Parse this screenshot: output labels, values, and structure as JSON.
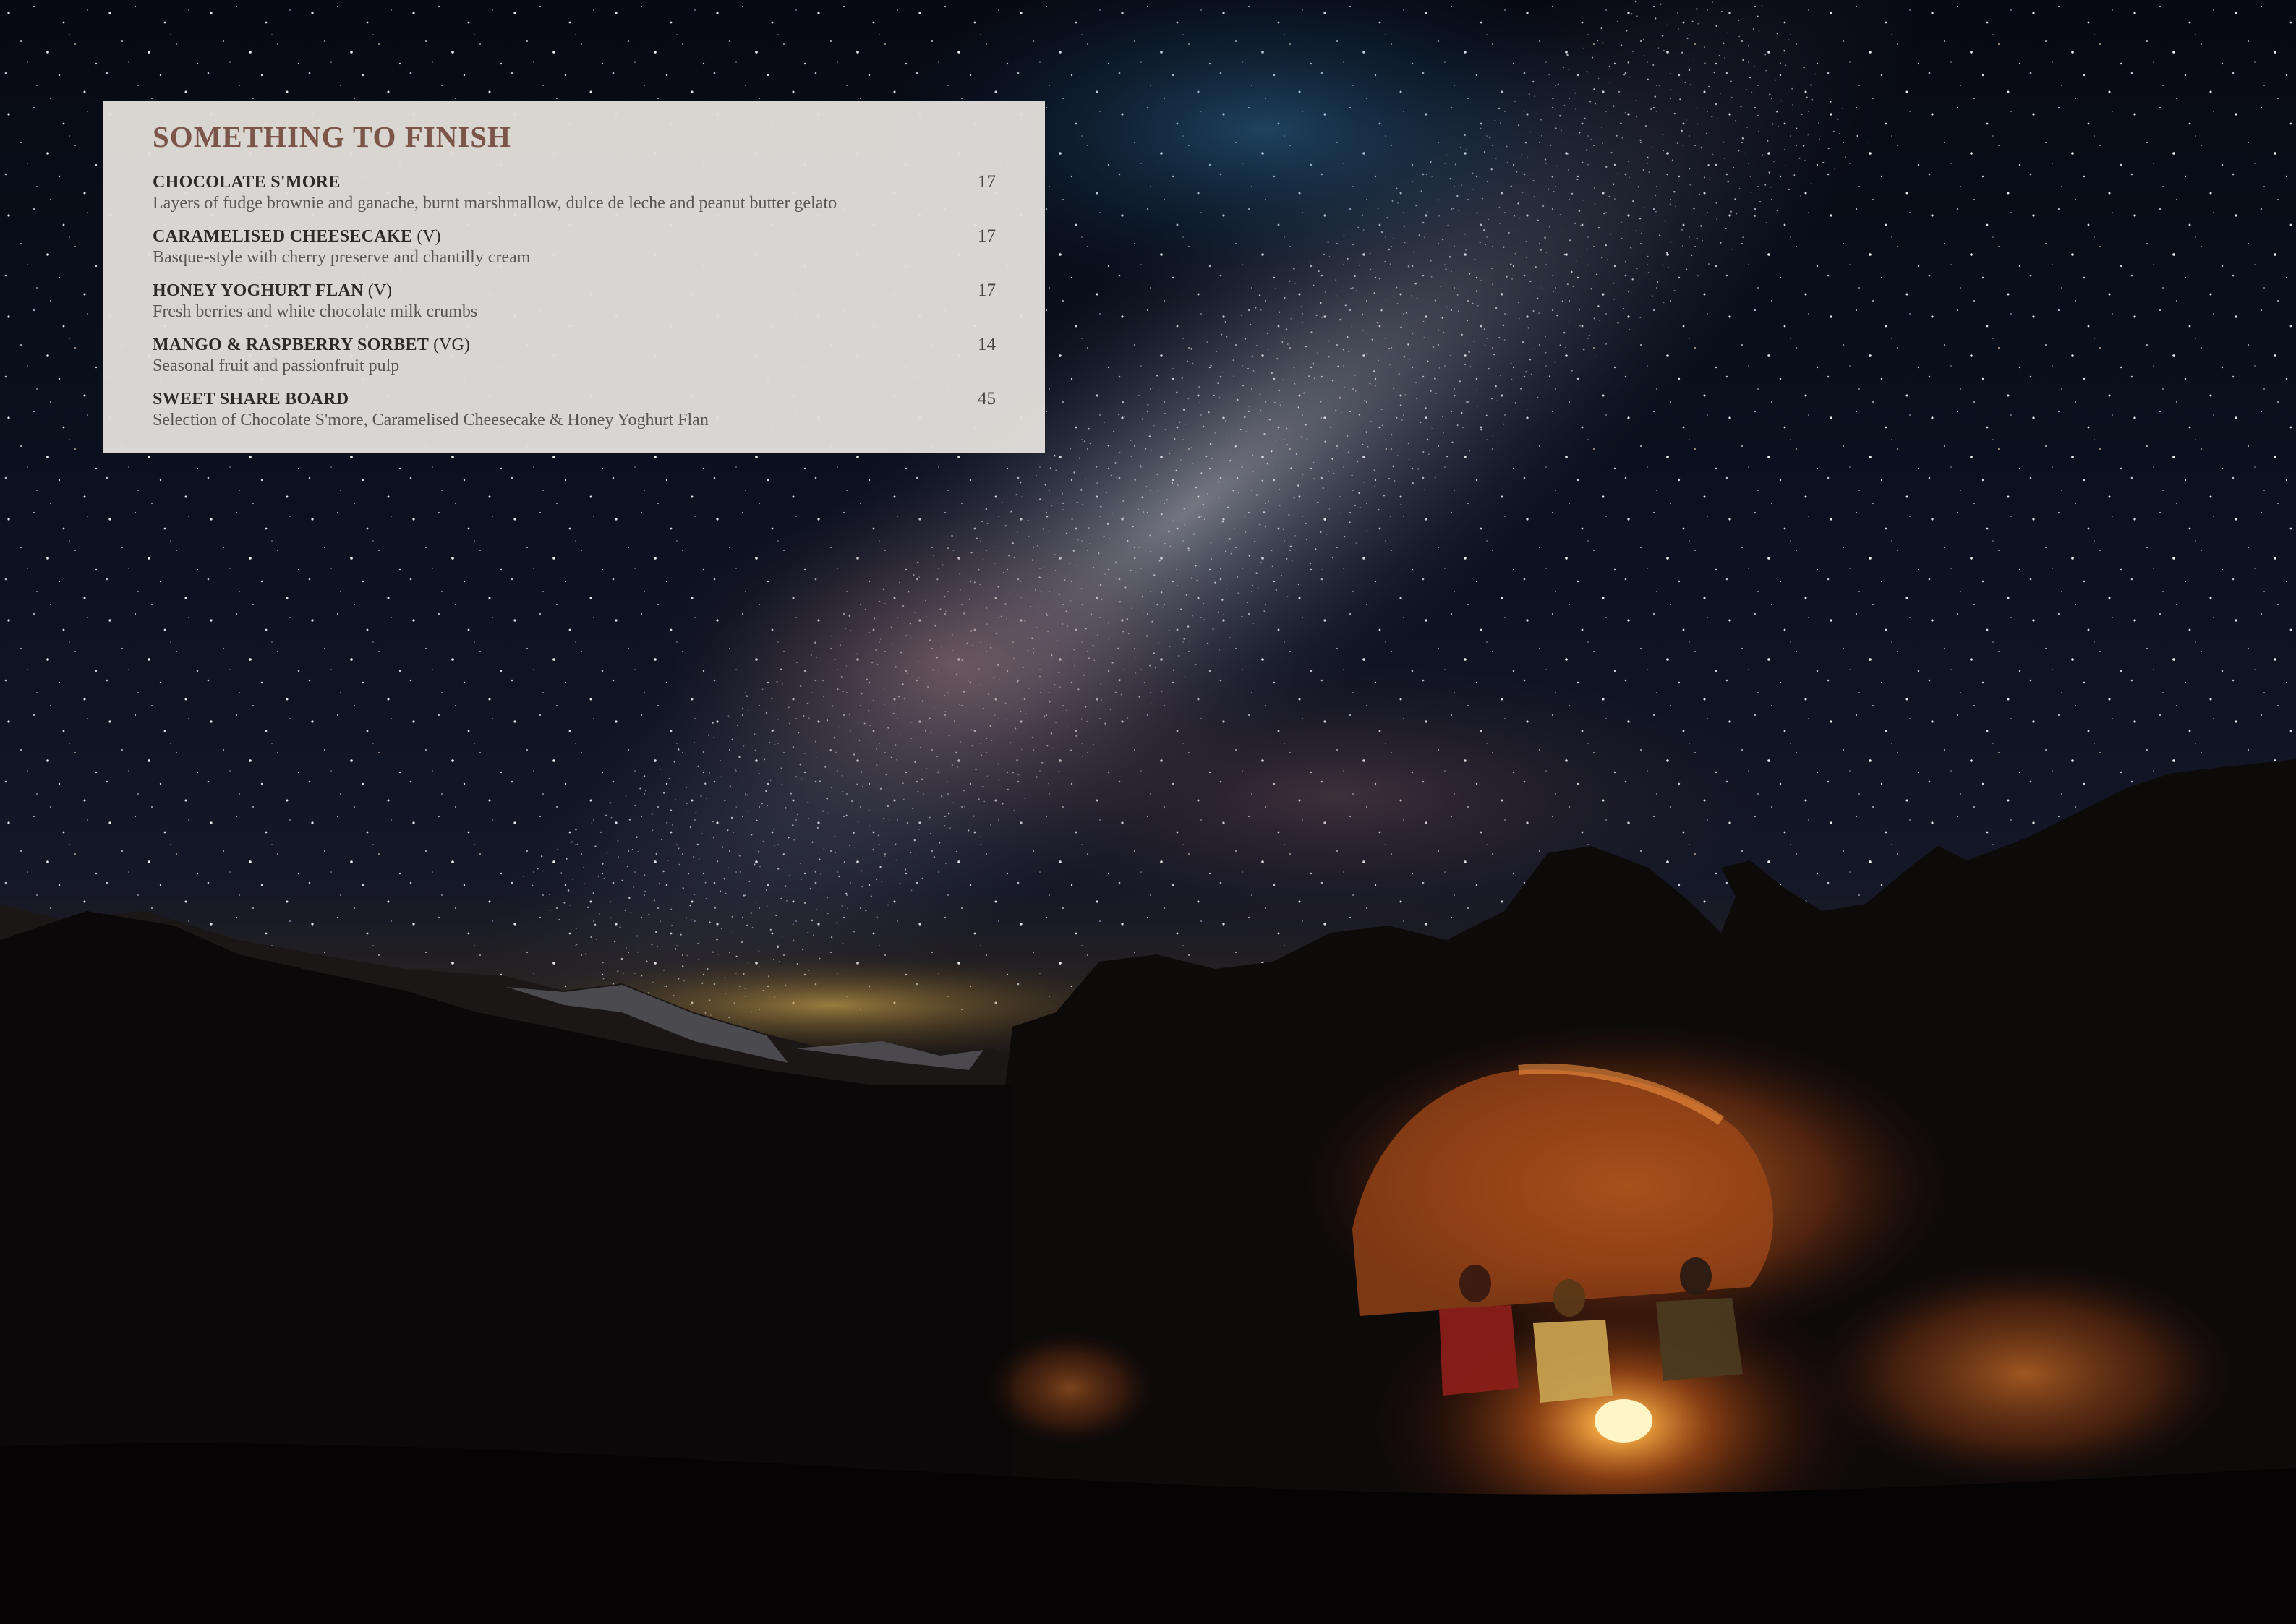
{
  "section": {
    "title": "SOMETHING TO FINISH"
  },
  "items": [
    {
      "name": "CHOCOLATE S'MORE",
      "tag": "",
      "description": "Layers of fudge brownie and ganache, burnt marshmallow, dulce de leche and peanut butter gelato",
      "price": "17"
    },
    {
      "name": "CARAMELISED CHEESECAKE",
      "tag": "(V)",
      "description": "Basque-style with cherry preserve and chantilly cream",
      "price": "17"
    },
    {
      "name": "HONEY YOGHURT FLAN",
      "tag": "(V)",
      "description": "Fresh berries and white chocolate milk crumbs",
      "price": "17"
    },
    {
      "name": "MANGO & RASPBERRY SORBET",
      "tag": "(VG)",
      "description": "Seasonal fruit and passionfruit pulp",
      "price": "14"
    },
    {
      "name": "SWEET SHARE BOARD",
      "tag": "",
      "description": "Selection of Chocolate S'more, Caramelised Cheesecake & Honey Yoghurt Flan",
      "price": "45"
    }
  ],
  "colors": {
    "title": "#7a5548",
    "panel": "#e2deda",
    "sky_top": "#0a0f1c",
    "fire_glow": "#ff9a2e"
  }
}
